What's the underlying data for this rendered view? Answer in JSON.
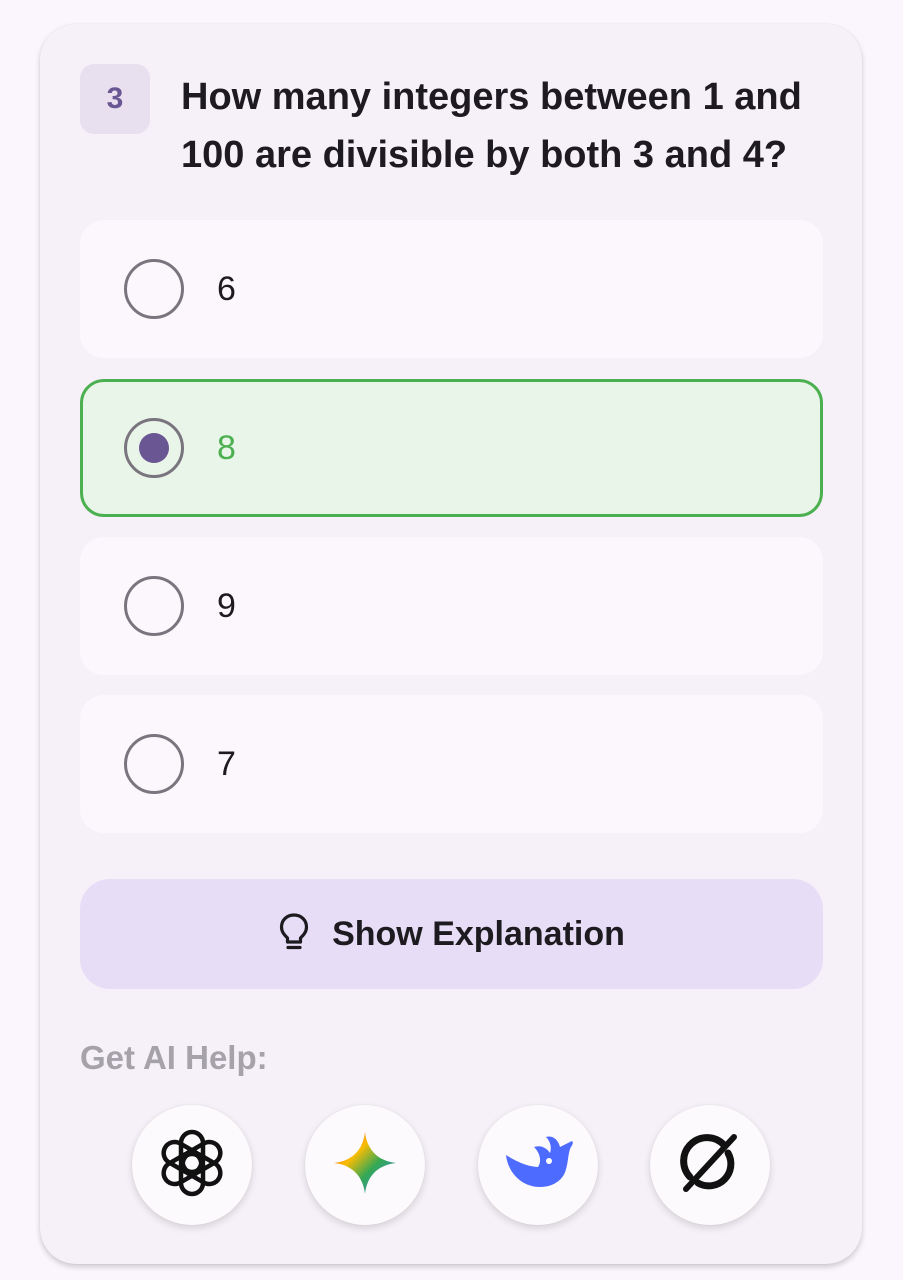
{
  "question": {
    "number": "3",
    "text": "How many integers between 1 and 100 are divisible by both 3 and 4?"
  },
  "options": [
    {
      "label": "6",
      "selected": false
    },
    {
      "label": "8",
      "selected": true
    },
    {
      "label": "9",
      "selected": false
    },
    {
      "label": "7",
      "selected": false
    }
  ],
  "explanation_button": {
    "label": "Show Explanation",
    "icon": "lightbulb-icon"
  },
  "ai_help": {
    "label": "Get AI Help:",
    "buttons": [
      {
        "icon": "chatgpt-icon"
      },
      {
        "icon": "gemini-icon"
      },
      {
        "icon": "deepseek-icon"
      },
      {
        "icon": "grok-icon"
      }
    ]
  },
  "colors": {
    "accent": "#6a5693",
    "correct": "#4caf50",
    "correct_bg": "#e8f5e8",
    "button_bg": "#e7ddf6"
  }
}
